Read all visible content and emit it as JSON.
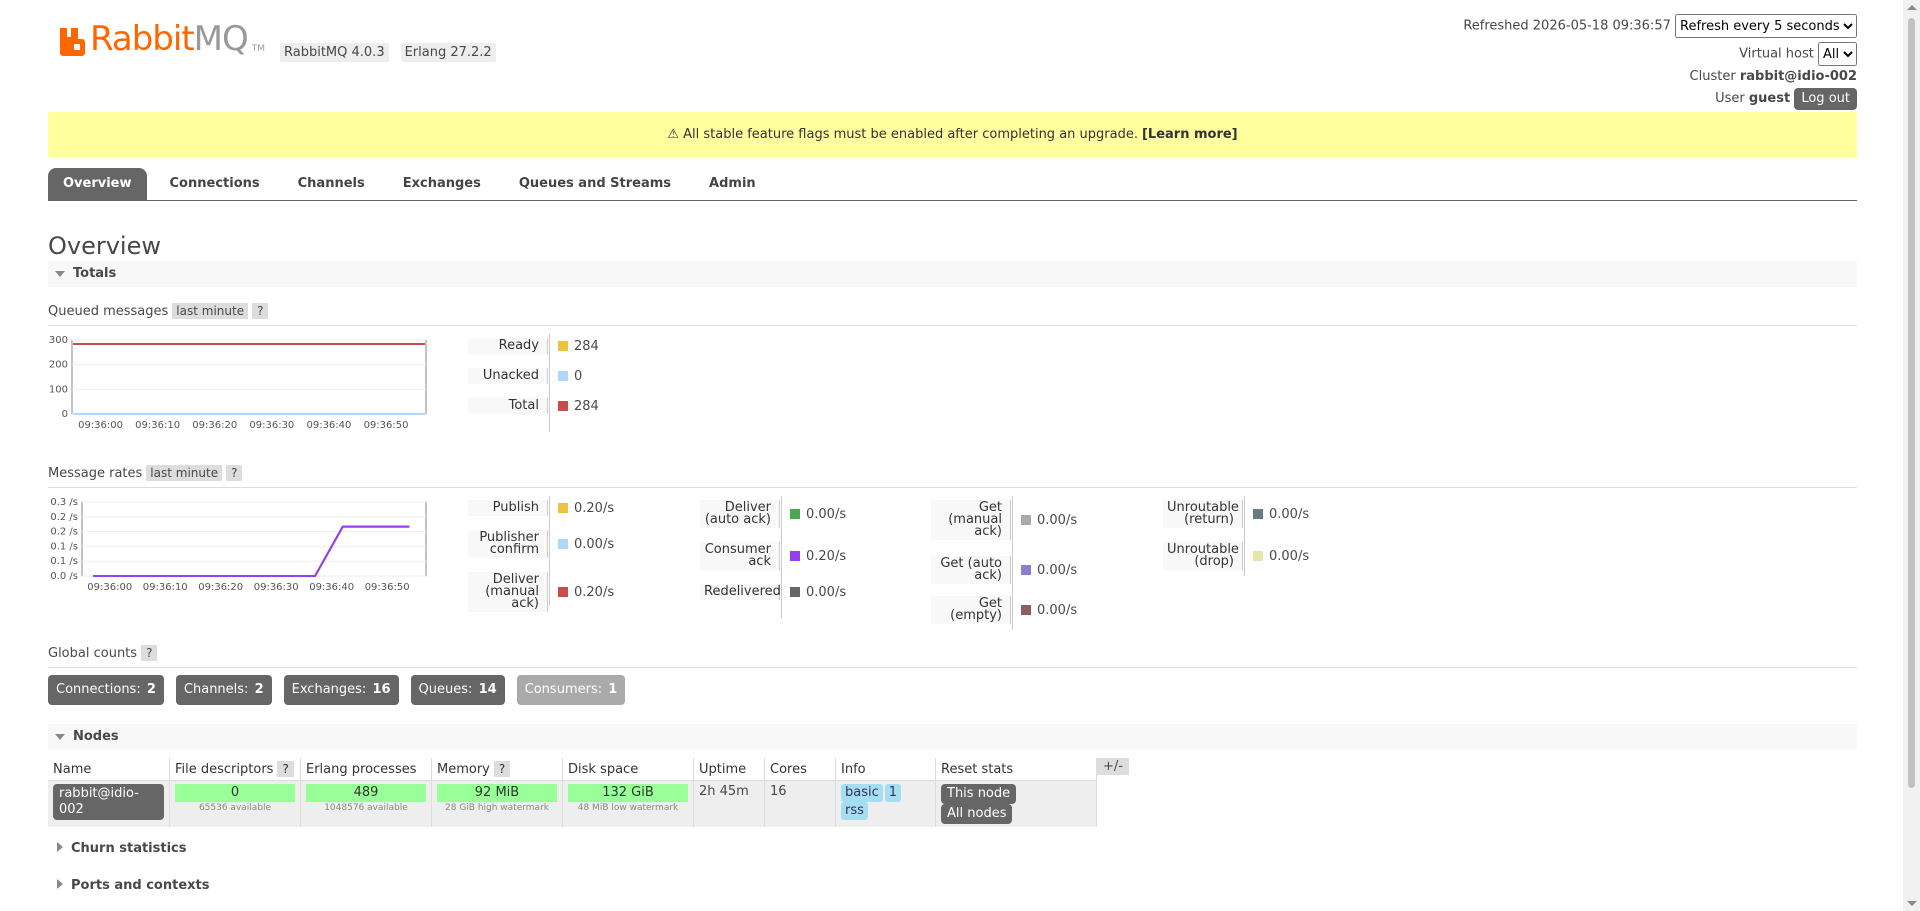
{
  "header": {
    "logo_rabbit": "Rabbit",
    "logo_mq": "MQ",
    "logo_tm": "TM",
    "version_rabbitmq": "RabbitMQ 4.0.3",
    "version_erlang": "Erlang 27.2.2",
    "refreshed_label": "Refreshed 2026-05-18 09:36:57",
    "refresh_select": "Refresh every 5 seconds",
    "virtual_host_label": "Virtual host",
    "virtual_host_value": "All",
    "cluster_label": "Cluster",
    "cluster_value": "rabbit@idio-002",
    "user_label": "User",
    "user_value": "guest",
    "logout_label": "Log out"
  },
  "banner": {
    "text": "⚠ All stable feature flags must be enabled after completing an upgrade.",
    "link": "[Learn more]"
  },
  "tabs": [
    "Overview",
    "Connections",
    "Channels",
    "Exchanges",
    "Queues and Streams",
    "Admin"
  ],
  "page_title": "Overview",
  "totals": {
    "title": "Totals",
    "queued_label": "Queued messages",
    "queued_range": "last minute",
    "help": "?",
    "rates_label": "Message rates",
    "rates_range": "last minute",
    "queued_legend": [
      {
        "label": "Ready",
        "value": "284",
        "color": "#edc240"
      },
      {
        "label": "Unacked",
        "value": "0",
        "color": "#afd8f8"
      },
      {
        "label": "Total",
        "value": "284",
        "color": "#cb4b4b"
      }
    ],
    "rates_legend": [
      [
        {
          "label": "Publish",
          "value": "0.20/s",
          "color": "#edc240"
        },
        {
          "label": "Publisher confirm",
          "value": "0.00/s",
          "color": "#afd8f8"
        },
        {
          "label": "Deliver (manual ack)",
          "value": "0.20/s",
          "color": "#cb4b4b"
        }
      ],
      [
        {
          "label": "Deliver (auto ack)",
          "value": "0.00/s",
          "color": "#4da74d"
        },
        {
          "label": "Consumer ack",
          "value": "0.20/s",
          "color": "#9440ed"
        },
        {
          "label": "Redelivered",
          "value": "0.00/s",
          "color": "#666666"
        }
      ],
      [
        {
          "label": "Get (manual ack)",
          "value": "0.00/s",
          "color": "#aaaaaa"
        },
        {
          "label": "Get (auto ack)",
          "value": "0.00/s",
          "color": "#8a7fd1"
        },
        {
          "label": "Get (empty)",
          "value": "0.00/s",
          "color": "#8c5f5a"
        }
      ],
      [
        {
          "label": "Unroutable (return)",
          "value": "0.00/s",
          "color": "#697b85"
        },
        {
          "label": "Unroutable (drop)",
          "value": "0.00/s",
          "color": "#e4e7a8"
        }
      ]
    ]
  },
  "chart_data": [
    {
      "type": "line",
      "x": [
        "09:36:00",
        "09:36:10",
        "09:36:20",
        "09:36:30",
        "09:36:40",
        "09:36:50"
      ],
      "ylim": [
        0,
        300
      ],
      "yticks": [
        "0",
        "100",
        "200",
        "300"
      ],
      "series": [
        {
          "name": "Ready",
          "values": [
            284,
            284,
            284,
            284,
            284,
            284
          ],
          "color": "#edc240"
        },
        {
          "name": "Unacked",
          "values": [
            0,
            0,
            0,
            0,
            0,
            0
          ],
          "color": "#afd8f8"
        },
        {
          "name": "Total",
          "values": [
            284,
            284,
            284,
            284,
            284,
            284
          ],
          "color": "#cb4b4b"
        }
      ]
    },
    {
      "type": "line",
      "x": [
        "09:36:00",
        "09:36:10",
        "09:36:20",
        "09:36:30",
        "09:36:40",
        "09:36:50"
      ],
      "ylim": [
        0,
        0.3
      ],
      "yticks": [
        "0.0 /s",
        "0.1 /s",
        "0.1 /s",
        "0.2 /s",
        "0.2 /s",
        "0.3 /s"
      ],
      "series": [
        {
          "name": "Publish",
          "x": [
            "09:35:57",
            "09:36:37",
            "09:36:42",
            "09:36:47",
            "09:36:54"
          ],
          "values": [
            0.0,
            0.0,
            0.2,
            0.2,
            0.2
          ],
          "color": "#edc240"
        },
        {
          "name": "Deliver (manual ack)",
          "x": [
            "09:35:57",
            "09:36:37",
            "09:36:42",
            "09:36:47",
            "09:36:54"
          ],
          "values": [
            0.0,
            0.0,
            0.2,
            0.2,
            0.2
          ],
          "color": "#cb4b4b"
        },
        {
          "name": "Consumer ack",
          "x": [
            "09:35:57",
            "09:36:37",
            "09:36:42",
            "09:36:47",
            "09:36:54"
          ],
          "values": [
            0.0,
            0.0,
            0.2,
            0.2,
            0.2
          ],
          "color": "#9440ed"
        }
      ]
    }
  ],
  "global_counts": {
    "title": "Global counts",
    "items": [
      {
        "label": "Connections:",
        "value": "2"
      },
      {
        "label": "Channels:",
        "value": "2"
      },
      {
        "label": "Exchanges:",
        "value": "16"
      },
      {
        "label": "Queues:",
        "value": "14"
      },
      {
        "label": "Consumers:",
        "value": "1"
      }
    ]
  },
  "nodes": {
    "title": "Nodes",
    "plus_minus": "+/-",
    "headers": [
      "Name",
      "File descriptors",
      "Erlang processes",
      "Memory",
      "Disk space",
      "Uptime",
      "Cores",
      "Info",
      "Reset stats"
    ],
    "row": {
      "name": "rabbit@idio-002",
      "fd": "0",
      "fd_sub": "65536 available",
      "erl": "489",
      "erl_sub": "1048576 available",
      "mem": "92 MiB",
      "mem_sub": "28 GiB high watermark",
      "disk": "132 GiB",
      "disk_sub": "48 MiB low watermark",
      "uptime": "2h 45m",
      "cores": "16",
      "info": [
        "basic",
        "1",
        "rss"
      ],
      "reset_this": "This node",
      "reset_all": "All nodes"
    }
  },
  "collapsed_sections": [
    "Churn statistics",
    "Ports and contexts"
  ]
}
